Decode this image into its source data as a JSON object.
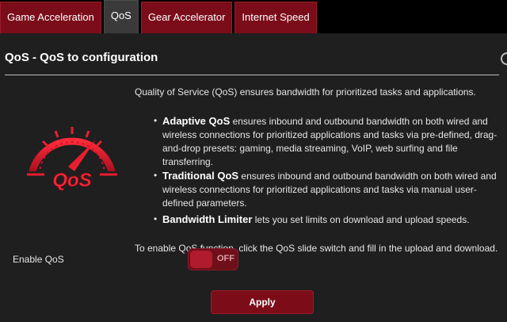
{
  "tabs": [
    {
      "label": "Game Acceleration",
      "active": false
    },
    {
      "label": "QoS",
      "active": true
    },
    {
      "label": "Gear Accelerator",
      "active": false
    },
    {
      "label": "Internet Speed",
      "active": false
    }
  ],
  "page": {
    "title": "QoS - QoS to configuration",
    "intro": "Quality of Service (QoS) ensures bandwidth for prioritized tasks and applications.",
    "bullets": [
      {
        "term": "Adaptive QoS",
        "text": " ensures inbound and outbound bandwidth on both wired and wireless connections for prioritized applications and tasks via pre-defined, drag-and-drop presets: gaming, media streaming, VoIP, web surfing and file transferring."
      },
      {
        "term": "Traditional QoS",
        "text": " ensures inbound and outbound bandwidth on both wired and wireless connections for prioritized applications and tasks via manual user-defined parameters."
      },
      {
        "term": "Bandwidth Limiter",
        "text": " lets you set limits on download and upload speeds."
      }
    ],
    "outro": "To enable QoS function, click the QoS slide switch and fill in the upload and download."
  },
  "logo": {
    "text": "QoS",
    "icon": "qos-speedometer-icon"
  },
  "enable": {
    "label": "Enable QoS",
    "state": "OFF"
  },
  "apply": {
    "label": "Apply"
  },
  "colors": {
    "accent": "#b01b2d",
    "tab_bg": "#7a0d19",
    "panel_bg": "#1f1f1f"
  }
}
